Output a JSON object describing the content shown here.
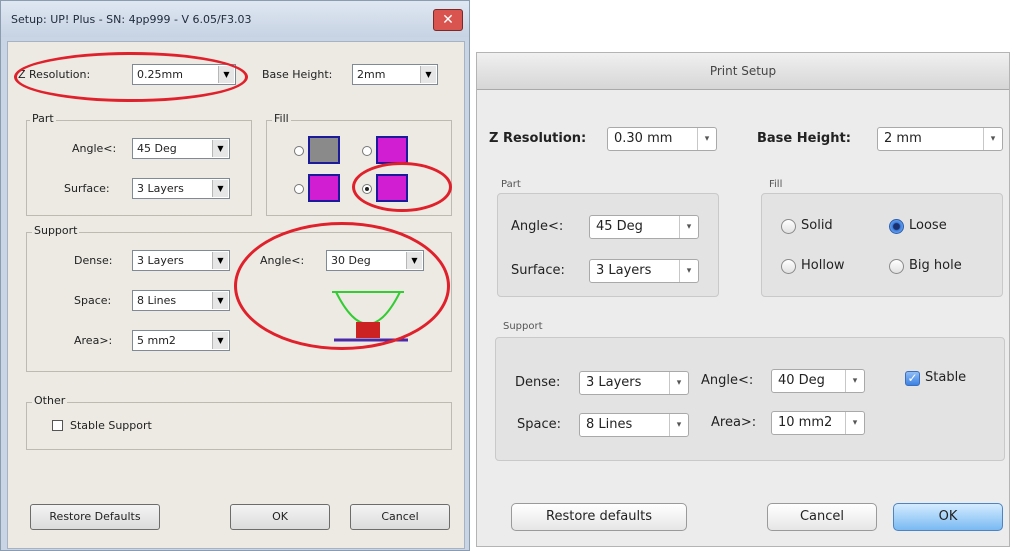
{
  "windows_dialog": {
    "title": "Setup: UP! Plus - SN: 4pp999 - V 6.05/F3.03",
    "close_glyph": "✕",
    "z_resolution_label": "Z Resolution:",
    "z_resolution_value": "0.25mm",
    "base_height_label": "Base Height:",
    "base_height_value": "2mm",
    "part": {
      "label": "Part",
      "angle_label": "Angle<:",
      "angle_value": "45 Deg",
      "surface_label": "Surface:",
      "surface_value": "3 Layers"
    },
    "fill": {
      "label": "Fill",
      "selected_index": 3,
      "swatch_colors": [
        "#8a8a8a",
        "#d21ed2",
        "#d21ed2",
        "#d21ed2"
      ]
    },
    "support": {
      "label": "Support",
      "dense_label": "Dense:",
      "dense_value": "3 Layers",
      "space_label": "Space:",
      "space_value": "8 Lines",
      "area_label": "Area>:",
      "area_value": "5 mm2",
      "angle_label": "Angle<:",
      "angle_value": "30 Deg"
    },
    "other": {
      "label": "Other",
      "stable_support_label": "Stable Support",
      "stable_support_checked": false
    },
    "buttons": {
      "restore": "Restore Defaults",
      "ok": "OK",
      "cancel": "Cancel"
    },
    "colors": {
      "highlight_circle": "#e0202a",
      "support_illustration_green": "#33cc33",
      "support_illustration_red": "#cc2222",
      "support_illustration_base": "#4b2aa8"
    }
  },
  "mac_dialog": {
    "title": "Print Setup",
    "z_resolution_label": "Z Resolution:",
    "z_resolution_value": "0.30 mm",
    "base_height_label": "Base Height:",
    "base_height_value": "2 mm",
    "part": {
      "label": "Part",
      "angle_label": "Angle<:",
      "angle_value": "45 Deg",
      "surface_label": "Surface:",
      "surface_value": "3 Layers"
    },
    "fill": {
      "label": "Fill",
      "options": [
        "Solid",
        "Loose",
        "Hollow",
        "Big hole"
      ],
      "selected": "Loose"
    },
    "support": {
      "label": "Support",
      "dense_label": "Dense:",
      "dense_value": "3 Layers",
      "space_label": "Space:",
      "space_value": "8 Lines",
      "angle_label": "Angle<:",
      "angle_value": "40 Deg",
      "area_label": "Area>:",
      "area_value": "10 mm2",
      "stable_label": "Stable",
      "stable_checked": true
    },
    "buttons": {
      "restore": "Restore defaults",
      "cancel": "Cancel",
      "ok": "OK"
    }
  }
}
